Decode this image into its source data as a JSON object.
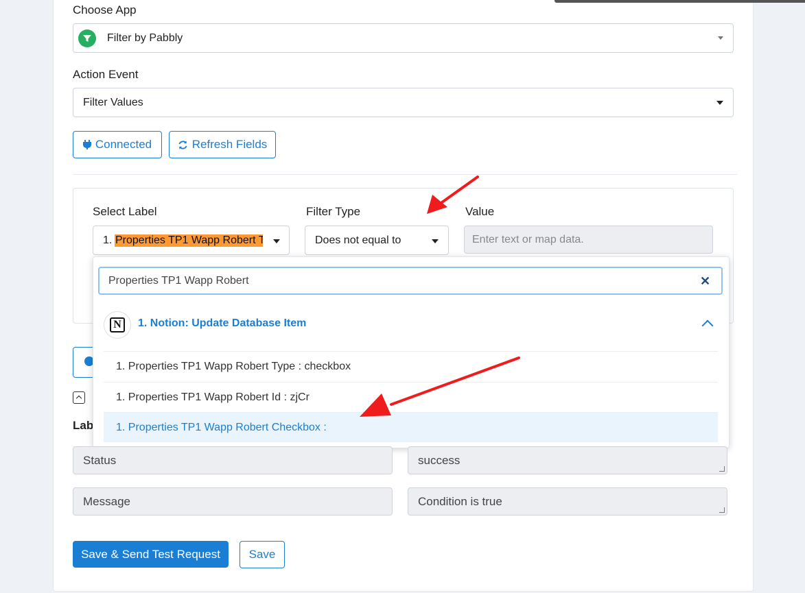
{
  "form": {
    "choose_app_label": "Choose App",
    "choose_app_value": "Filter by Pabbly",
    "action_event_label": "Action Event",
    "action_event_value": "Filter Values",
    "connected_label": "Connected",
    "refresh_label": "Refresh Fields"
  },
  "filter": {
    "select_label_heading": "Select Label",
    "filter_type_heading": "Filter Type",
    "value_heading": "Value",
    "select_label_prefix": "1.",
    "select_label_value": "Properties TP1 Wapp Robert T",
    "filter_type_value": "Does not equal to",
    "value_placeholder": "Enter text or map data."
  },
  "dropdown": {
    "search_value": "Properties TP1 Wapp Robert",
    "group_title": "1. Notion: Update Database Item",
    "options": [
      "1. Properties TP1 Wapp Robert Type : checkbox",
      "1. Properties TP1 Wapp Robert Id : zjCr",
      "1. Properties TP1 Wapp Robert Checkbox :"
    ]
  },
  "response": {
    "label_partial": "Lab",
    "rows": [
      {
        "label": "Status",
        "value": "success"
      },
      {
        "label": "Message",
        "value": "Condition is true"
      }
    ]
  },
  "actions": {
    "save_send_label": "Save & Send Test Request",
    "save_label": "Save"
  },
  "colors": {
    "accent": "#1a7fd4",
    "highlight": "#ff9933",
    "arrow": "#ee1c1c",
    "pabbly_green": "#27ae60"
  }
}
